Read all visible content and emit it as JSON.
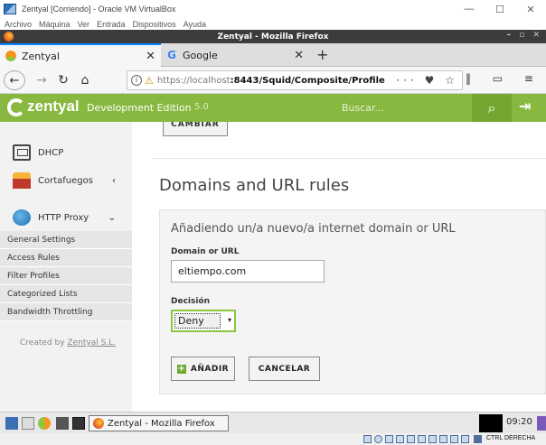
{
  "vbox": {
    "title": "Zentyal [Corriendo] - Oracle VM VirtualBox",
    "menu": [
      "Archivo",
      "Máquina",
      "Ver",
      "Entrada",
      "Dispositivos",
      "Ayuda"
    ],
    "controls": {
      "minimize": "—",
      "maximize": "☐",
      "close": "✕"
    },
    "host_key": "CTRL DERECHA"
  },
  "firefox": {
    "window_title": "Zentyal - Mozilla Firefox",
    "tabs": [
      {
        "label": "Zentyal",
        "icon": "zentyal-icon",
        "active": true
      },
      {
        "label": "Google",
        "icon": "google-icon",
        "active": false
      }
    ],
    "url_host": "https://localhost",
    "url_path": ":8443/Squid/Composite/Profile",
    "url_menu": "···",
    "new_tab": "+"
  },
  "zentyal": {
    "brand": "zentyal",
    "edition": "Development Edition",
    "version": "5.0",
    "search_placeholder": "Buscar...",
    "accent": "#88b83f"
  },
  "sidebar": {
    "items": [
      {
        "label": "DHCP",
        "icon": "dhcp-icon"
      },
      {
        "label": "Cortafuegos",
        "icon": "firewall-icon",
        "caret": "‹"
      },
      {
        "label": "HTTP Proxy",
        "icon": "http-proxy-icon",
        "caret": "⌄"
      }
    ],
    "subitems": [
      "General Settings",
      "Access Rules",
      "Filter Profiles",
      "Categorized Lists",
      "Bandwidth Throttling"
    ],
    "credit_prefix": "Created by",
    "credit_link": "Zentyal S.L."
  },
  "main": {
    "top_button": "CAMBIAR",
    "title": "Domains and URL rules",
    "form_heading": "Añadiendo un/a nuevo/a internet domain or URL",
    "domain_label": "Domain or URL",
    "domain_value": "eltiempo.com",
    "decision_label": "Decisión",
    "decision_value": "Deny",
    "add_button": "AÑADIR",
    "cancel_button": "CANCELAR"
  },
  "taskbar": {
    "app_label": "Zentyal - Mozilla Firefox",
    "clock": "09:20"
  }
}
